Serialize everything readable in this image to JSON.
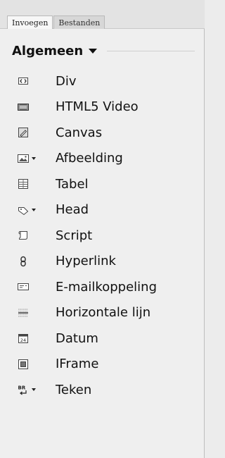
{
  "tabs": [
    {
      "label": "Invoegen",
      "active": true
    },
    {
      "label": "Bestanden",
      "active": false
    }
  ],
  "category": {
    "label": "Algemeen"
  },
  "items": [
    {
      "label": "Div",
      "icon": "div-icon",
      "has_dropdown": false
    },
    {
      "label": "HTML5 Video",
      "icon": "video-icon",
      "has_dropdown": false
    },
    {
      "label": "Canvas",
      "icon": "canvas-icon",
      "has_dropdown": false
    },
    {
      "label": "Afbeelding",
      "icon": "image-icon",
      "has_dropdown": true
    },
    {
      "label": "Tabel",
      "icon": "table-icon",
      "has_dropdown": false
    },
    {
      "label": "Head",
      "icon": "tag-icon",
      "has_dropdown": true
    },
    {
      "label": "Script",
      "icon": "script-icon",
      "has_dropdown": false
    },
    {
      "label": "Hyperlink",
      "icon": "hyperlink-icon",
      "has_dropdown": false
    },
    {
      "label": "E-mailkoppeling",
      "icon": "email-icon",
      "has_dropdown": false
    },
    {
      "label": "Horizontale lijn",
      "icon": "horizontal-rule-icon",
      "has_dropdown": false
    },
    {
      "label": "Datum",
      "icon": "date-icon",
      "has_dropdown": false
    },
    {
      "label": "IFrame",
      "icon": "iframe-icon",
      "has_dropdown": false
    },
    {
      "label": "Teken",
      "icon": "character-icon",
      "has_dropdown": true
    }
  ],
  "date_icon_text": "24",
  "character_icon_text": "BR"
}
